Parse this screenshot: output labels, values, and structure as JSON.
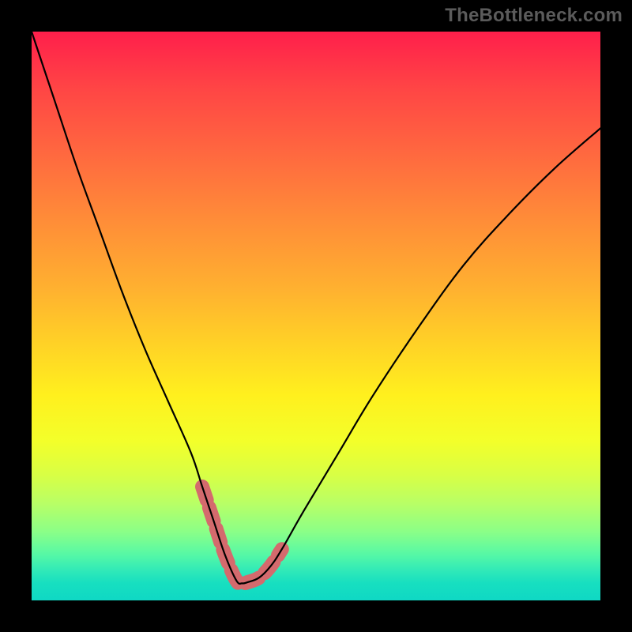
{
  "watermark": "TheBottleneck.com",
  "colors": {
    "background": "#000000",
    "watermark_text": "#5b5b5b",
    "curve": "#000000",
    "highlight": "#d46a6d",
    "gradient_top": "#ff1f4b",
    "gradient_bottom": "#0fd8c4"
  },
  "chart_data": {
    "type": "line",
    "title": "",
    "xlabel": "",
    "ylabel": "",
    "xlim": [
      0,
      100
    ],
    "ylim": [
      0,
      100
    ],
    "grid": false,
    "note": "Values estimated from pixels; chart has no axes or tick labels. x spans plot width, y is normalized 0 (bottom, good) to 100 (top, severe). Minimum around x≈37.",
    "series": [
      {
        "name": "bottleneck-curve",
        "x": [
          0,
          4,
          8,
          12,
          16,
          20,
          24,
          28,
          30,
          32,
          34,
          36,
          37,
          38,
          40,
          42,
          44,
          48,
          54,
          60,
          68,
          76,
          84,
          92,
          100
        ],
        "values": [
          100,
          88,
          76,
          65,
          54,
          44,
          35,
          26,
          20,
          14,
          8,
          3.5,
          3,
          3.2,
          4,
          6,
          9,
          16,
          26,
          36,
          48,
          59,
          68,
          76,
          83
        ]
      },
      {
        "name": "optimal-zone-highlight",
        "x": [
          30,
          32,
          34,
          36,
          37,
          38,
          40,
          42,
          44
        ],
        "values": [
          20,
          14,
          8,
          3.5,
          3,
          3.2,
          4,
          6,
          9
        ]
      }
    ]
  }
}
